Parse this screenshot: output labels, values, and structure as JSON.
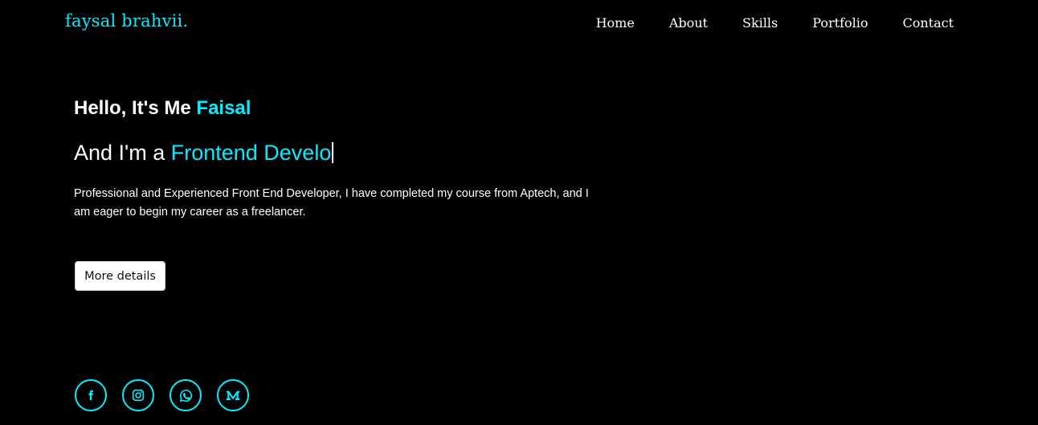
{
  "brand": {
    "name": "faysal brahvii."
  },
  "nav": {
    "items": [
      {
        "label": "Home"
      },
      {
        "label": "About"
      },
      {
        "label": "Skills"
      },
      {
        "label": "Portfolio"
      },
      {
        "label": "Contact"
      }
    ]
  },
  "hero": {
    "greeting_prefix": "Hello, It's Me ",
    "greeting_name": "Faisal",
    "role_prefix": "And I'm a ",
    "role_typed": "Frontend Develo",
    "description": "Professional and Experienced Front End Developer, I have completed my course from Aptech, and I am eager to begin my career as a freelancer.",
    "button_label": "More details"
  },
  "social": {
    "icons": [
      "facebook-icon",
      "instagram-icon",
      "whatsapp-icon",
      "medium-icon"
    ]
  },
  "colors": {
    "background": "#000000",
    "accent": "#00eeff",
    "text": "#ffffff"
  }
}
